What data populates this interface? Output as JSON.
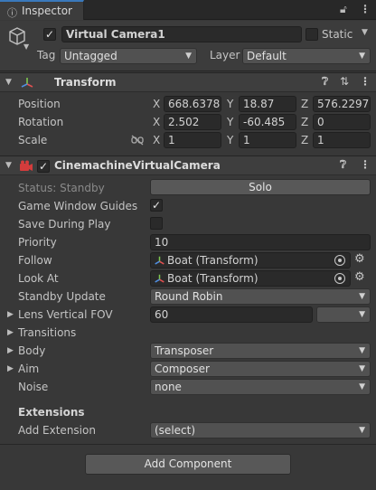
{
  "tab": {
    "icon": "info-icon",
    "label": "Inspector"
  },
  "toolbar": {
    "lock_icon": "lock-icon",
    "menu_icon": "kebab-menu-icon"
  },
  "gameobject": {
    "name": "Virtual Camera1",
    "active": true,
    "static_label": "Static",
    "tag_label": "Tag",
    "tag_value": "Untagged",
    "layer_label": "Layer",
    "layer_value": "Default"
  },
  "transform": {
    "title": "Transform",
    "position_label": "Position",
    "rotation_label": "Rotation",
    "scale_label": "Scale",
    "axes": {
      "x": "X",
      "y": "Y",
      "z": "Z"
    },
    "position": {
      "x": "668.6378",
      "y": "18.87",
      "z": "576.2297"
    },
    "rotation": {
      "x": "2.502",
      "y": "-60.485",
      "z": "0"
    },
    "scale": {
      "x": "1",
      "y": "1",
      "z": "1"
    }
  },
  "vcam": {
    "title": "CinemachineVirtualCamera",
    "enabled": true,
    "status_label": "Status: Standby",
    "solo_label": "Solo",
    "game_window_guides_label": "Game Window Guides",
    "game_window_guides": true,
    "save_during_play_label": "Save During Play",
    "save_during_play": false,
    "priority_label": "Priority",
    "priority": "10",
    "follow_label": "Follow",
    "follow_value": "Boat (Transform)",
    "look_at_label": "Look At",
    "look_at_value": "Boat (Transform)",
    "standby_update_label": "Standby Update",
    "standby_update": "Round Robin",
    "lens_fov_label": "Lens Vertical FOV",
    "lens_fov": "60",
    "transitions_label": "Transitions",
    "body_label": "Body",
    "body_value": "Transposer",
    "aim_label": "Aim",
    "aim_value": "Composer",
    "noise_label": "Noise",
    "noise_value": "none",
    "extensions_label": "Extensions",
    "add_extension_label": "Add Extension",
    "add_extension_value": "(select)"
  },
  "add_component_label": "Add Component",
  "colors": {
    "accent_tab": "#3a79bb",
    "background": "#383838",
    "field_bg": "#2a2a2a",
    "button_bg": "#585858"
  }
}
